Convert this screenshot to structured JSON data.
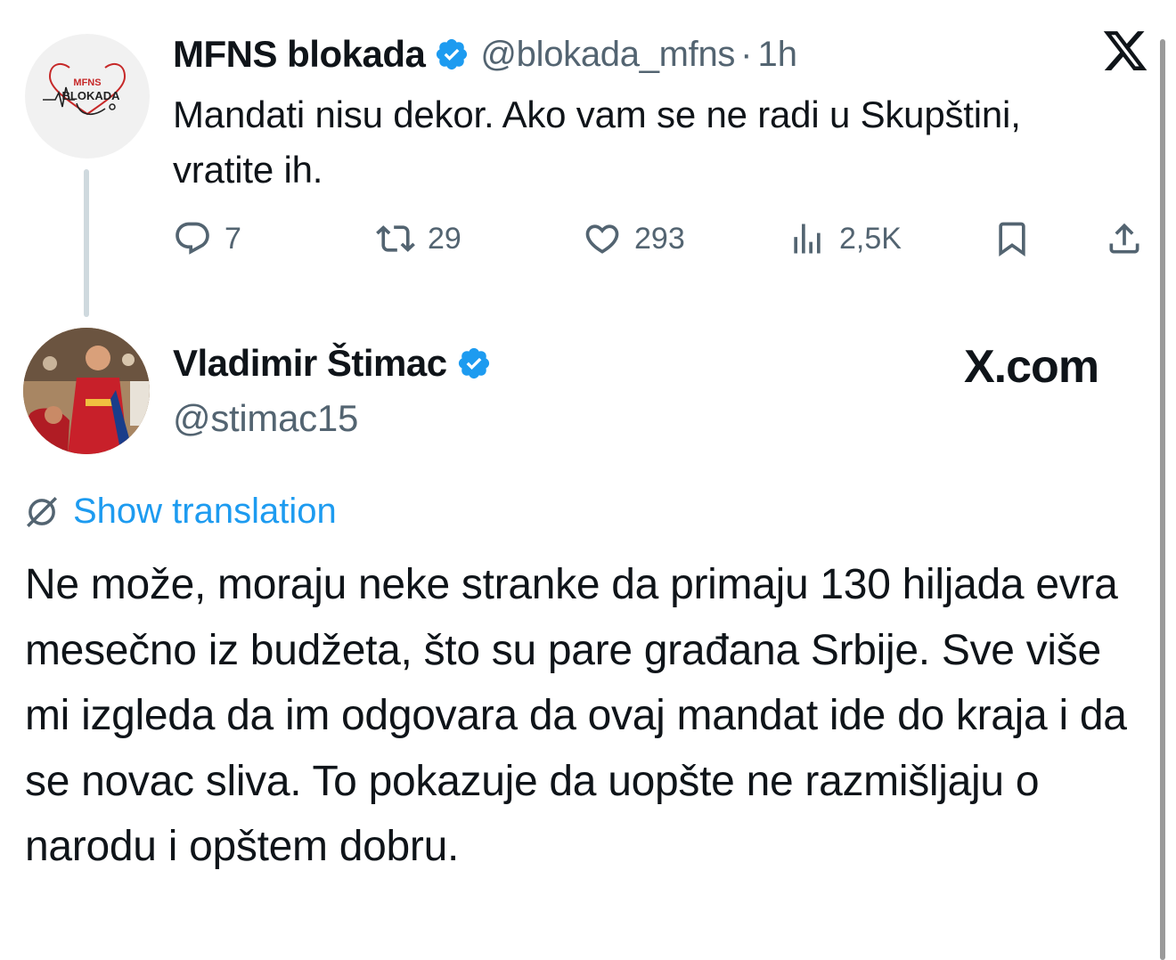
{
  "parent_tweet": {
    "display_name": "MFNS blokada",
    "handle": "@blokada_mfns",
    "separator": "·",
    "time": "1h",
    "avatar_logo_top": "MFNS",
    "avatar_logo_bottom": "BLOKADA",
    "text": "Mandati nisu dekor. Ako vam se ne radi u Skupštini, vratite ih.",
    "actions": {
      "replies": "7",
      "reposts": "29",
      "likes": "293",
      "views": "2,5K"
    }
  },
  "reply_tweet": {
    "display_name": "Vladimir Štimac",
    "handle": "@stimac15",
    "site_label": "X.com",
    "show_translation": "Show translation",
    "text": "Ne može, moraju neke stranke da primaju 130 hiljada evra mesečno iz budžeta, što su pare građana Srbije. Sve više mi izgleda da im odgovara da ovaj mandat ide do kraja i da se novac sliva. To pokazuje da uopšte ne razmišljaju o narodu i opštem dobru."
  },
  "colors": {
    "text": "#0f1419",
    "secondary": "#536471",
    "accent": "#1d9bf0",
    "verified": "#1d9bf0"
  },
  "icons": [
    "x-logo-icon",
    "verified-badge-icon",
    "reply-icon",
    "repost-icon",
    "like-icon",
    "views-icon",
    "bookmark-icon",
    "share-icon",
    "translate-icon"
  ]
}
